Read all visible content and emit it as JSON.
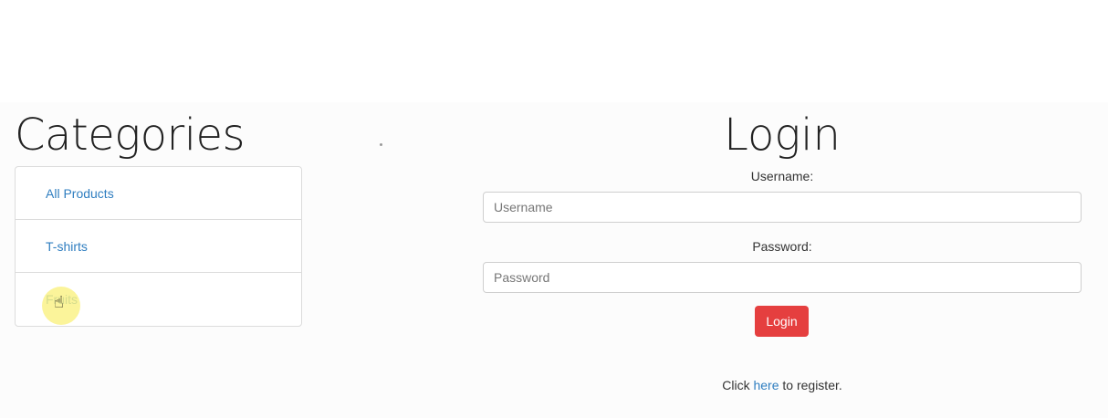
{
  "categories": {
    "title": "Categories",
    "items": [
      {
        "label": "All Products"
      },
      {
        "label": "T-shirts"
      },
      {
        "label": "Fruits"
      }
    ]
  },
  "login": {
    "title": "Login",
    "username_label": "Username:",
    "username_placeholder": "Username",
    "username_value": "",
    "password_label": "Password:",
    "password_placeholder": "Password",
    "password_value": "",
    "submit_label": "Login",
    "register_prefix": "Click",
    "register_link": "here",
    "register_suffix": "to register."
  },
  "icons": {
    "cursor": "hand-pointer-icon"
  },
  "colors": {
    "link": "#2f7ec0",
    "login_button": "#e53f3f",
    "cursor_highlight": "#faf078"
  }
}
